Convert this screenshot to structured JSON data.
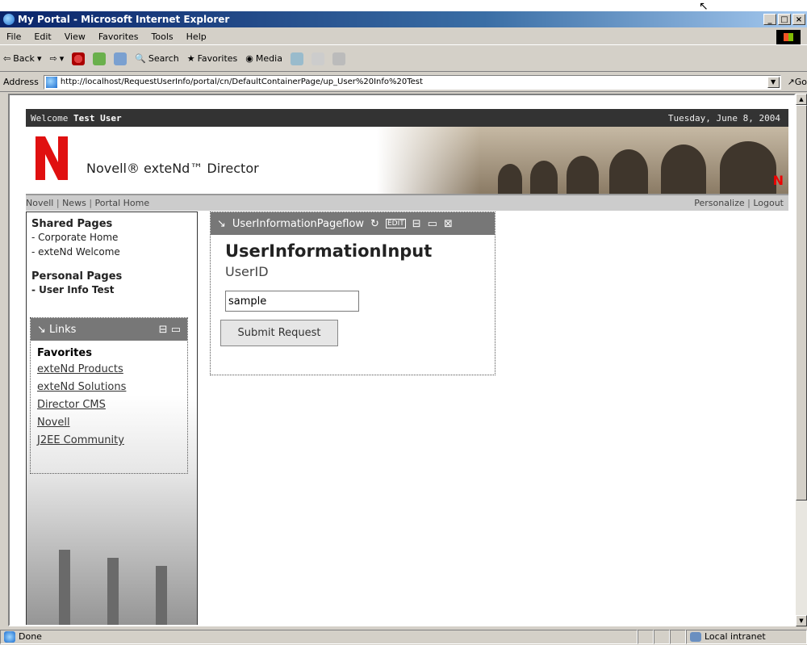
{
  "window": {
    "title": "My Portal - Microsoft Internet Explorer"
  },
  "menu": [
    "File",
    "Edit",
    "View",
    "Favorites",
    "Tools",
    "Help"
  ],
  "toolbar": {
    "back": "Back",
    "search": "Search",
    "favorites": "Favorites",
    "media": "Media"
  },
  "address": {
    "label": "Address",
    "url": "http://localhost/RequestUserInfo/portal/cn/DefaultContainerPage/up_User%20Info%20Test",
    "go": "Go"
  },
  "portal": {
    "welcome_prefix": "Welcome",
    "user": "Test User",
    "date": "Tuesday, June 8, 2004",
    "brand": "Novell® exteNd™ Director",
    "nav_left": [
      "Novell",
      "News",
      "Portal Home"
    ],
    "nav_right": [
      "Personalize",
      "Logout"
    ]
  },
  "sidebar": {
    "shared_title": "Shared Pages",
    "shared_items": [
      "- Corporate Home",
      "- exteNd Welcome"
    ],
    "personal_title": "Personal Pages",
    "personal_items": [
      "- User Info Test"
    ]
  },
  "links_portlet": {
    "title": "Links",
    "favorites_title": "Favorites",
    "links": [
      "exteNd Products",
      "exteNd Solutions",
      "Director CMS",
      "Novell",
      "J2EE Community"
    ]
  },
  "main_portlet": {
    "title": "UserInformationPageflow",
    "heading": "UserInformationInput",
    "field_label": "UserID",
    "field_value": "sample",
    "submit_label": "Submit Request"
  },
  "status": {
    "text": "Done",
    "zone": "Local intranet"
  }
}
